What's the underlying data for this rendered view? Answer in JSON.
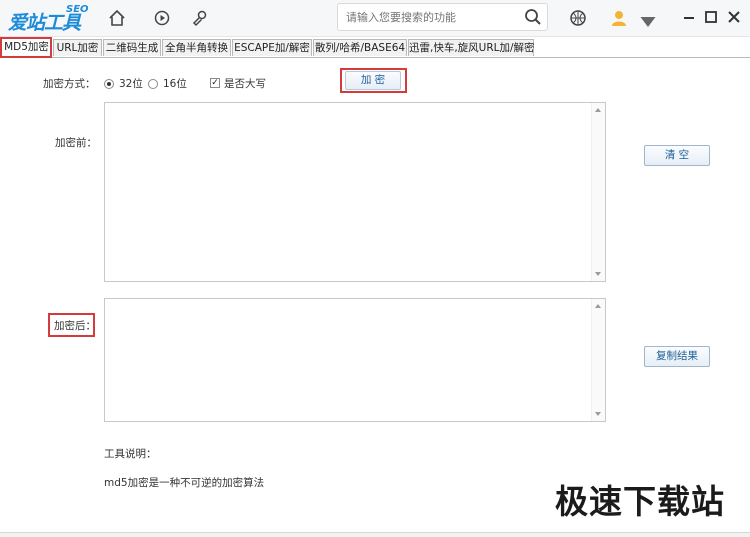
{
  "app": {
    "logo_text": "爱站工具包",
    "logo_sup": "SEO",
    "search_placeholder": "请输入您要搜索的功能"
  },
  "tabs": [
    {
      "label": "MD5加密",
      "active": true
    },
    {
      "label": "URL加密"
    },
    {
      "label": "二维码生成"
    },
    {
      "label": "全角半角转换"
    },
    {
      "label": "ESCAPE加/解密"
    },
    {
      "label": "散列/哈希/BASE64"
    },
    {
      "label": "迅雷,快车,旋风URL加/解密"
    }
  ],
  "form": {
    "method_label": "加密方式：",
    "option_32": "32位",
    "option_16": "16位",
    "selected": "32位",
    "uppercase_label": "是否大写",
    "uppercase_checked": true,
    "encrypt_button": "加  密",
    "before_label": "加密前：",
    "before_value": "",
    "after_label": "加密后：",
    "after_value": "",
    "clear_button": "清  空",
    "copy_button": "复制结果"
  },
  "help": {
    "title": "工具说明：",
    "text": "md5加密是一种不可逆的加密算法"
  },
  "watermark": "极速下载站"
}
